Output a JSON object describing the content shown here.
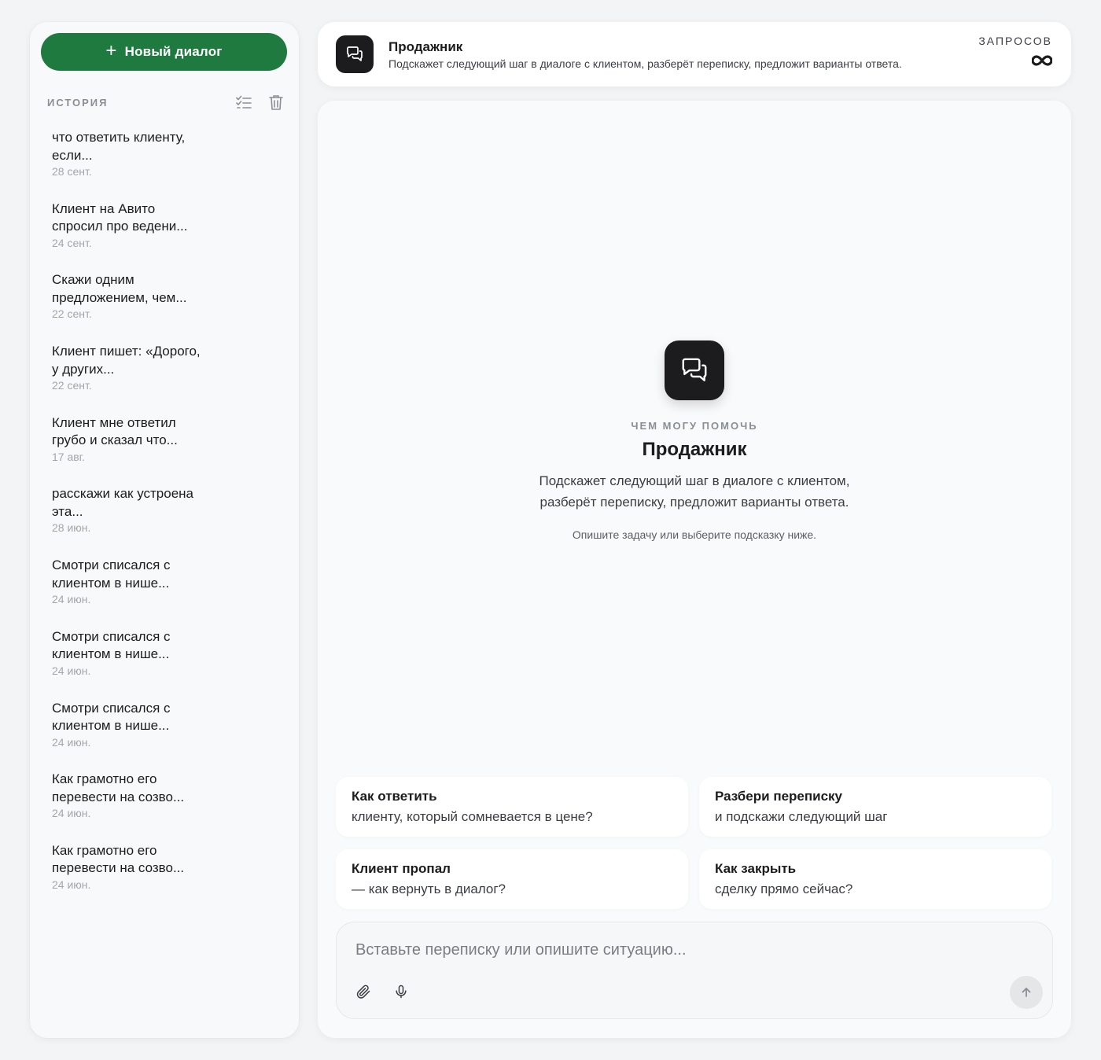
{
  "sidebar": {
    "new_dialog_label": "Новый диалог",
    "history_label": "ИСТОРИЯ",
    "history": [
      {
        "title": "что ответить клиенту, если...",
        "date": "28 сент."
      },
      {
        "title": "Клиент на Авито спросил про ведени...",
        "date": "24 сент."
      },
      {
        "title": "Скажи одним предложением, чем...",
        "date": "22 сент."
      },
      {
        "title": "Клиент пишет: «Дорого, у других...",
        "date": "22 сент."
      },
      {
        "title": "Клиент мне ответил грубо и сказал что...",
        "date": "17 авг."
      },
      {
        "title": "расскажи как устроена эта...",
        "date": "28 июн."
      },
      {
        "title": "Смотри списался с клиентом в нише...",
        "date": "24 июн."
      },
      {
        "title": "Смотри списался с клиентом в нише...",
        "date": "24 июн."
      },
      {
        "title": "Смотри списался с клиентом в нише...",
        "date": "24 июн."
      },
      {
        "title": "Как грамотно его перевести на созво...",
        "date": "24 июн."
      },
      {
        "title": "Как грамотно его перевести на созво...",
        "date": "24 июн."
      }
    ]
  },
  "header": {
    "title": "Продажник",
    "subtitle": "Подскажет следующий шаг в диалоге с клиентом, разберёт переписку, предложит варианты ответа.",
    "requests_label": "ЗАПРОСОВ",
    "requests_value_icon": "infinity-icon"
  },
  "hero": {
    "eyebrow": "ЧЕМ МОГУ ПОМОЧЬ",
    "title": "Продажник",
    "description_line1": "Подскажет следующий шаг в диалоге с клиентом,",
    "description_line2": "разберёт переписку, предложит варианты ответа.",
    "hint": "Опишите задачу или выберите подсказку ниже."
  },
  "suggestions": [
    {
      "title": "Как ответить",
      "subtitle": "клиенту, который сомневается в цене?"
    },
    {
      "title": "Разбери переписку",
      "subtitle": "и подскажи следующий шаг"
    },
    {
      "title": "Клиент пропал",
      "subtitle": "— как вернуть в диалог?"
    },
    {
      "title": "Как закрыть",
      "subtitle": "сделку прямо сейчас?"
    }
  ],
  "composer": {
    "placeholder": "Вставьте переписку или опишите ситуацию...",
    "value": ""
  },
  "colors": {
    "accent": "#1f7a40",
    "dark": "#1c1c1e"
  }
}
